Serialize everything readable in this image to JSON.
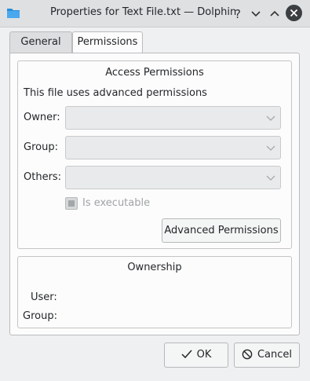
{
  "window": {
    "title": "Properties for Text File.txt — Dolphin",
    "app_icon": "folder-icon",
    "controls": [
      "help-icon",
      "minimize-icon",
      "maximize-icon",
      "close-icon"
    ]
  },
  "tabs": [
    {
      "label": "General",
      "active": false
    },
    {
      "label": "Permissions",
      "active": true
    }
  ],
  "access": {
    "title": "Access Permissions",
    "info": "This file uses advanced permissions",
    "owner_label": "Owner:",
    "group_label": "Group:",
    "others_label": "Others:",
    "owner_value": "",
    "group_value": "",
    "others_value": "",
    "executable_label": "Is executable",
    "advanced_button": "Advanced Permissions"
  },
  "ownership": {
    "title": "Ownership",
    "user_label": "User:",
    "group_label": "Group:"
  },
  "footer": {
    "ok_label": "OK",
    "cancel_label": "Cancel"
  },
  "colors": {
    "window_bg": "#eff0f1",
    "panel_bg": "#fcfcfc",
    "titlebar_bg": "#dee0e2",
    "disabled_text": "#a0a3a6",
    "close_button": "#3b3f42"
  }
}
